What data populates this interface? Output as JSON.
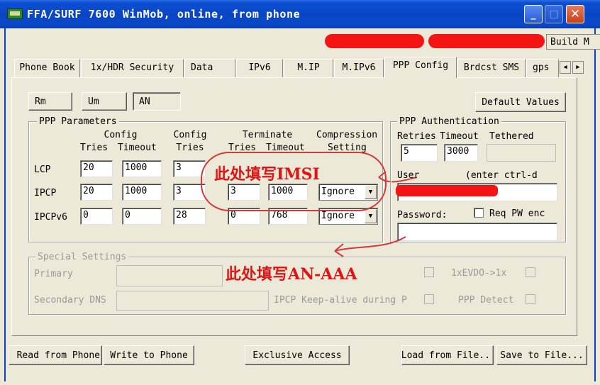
{
  "window": {
    "title": "FFA/SURF 7600 WinMob, online, from phone",
    "minimize_glyph": "_",
    "maximize_glyph": "□",
    "close_glyph": "✕",
    "build_label": "Build M"
  },
  "tabs": [
    {
      "label": "Phone Book",
      "active": false
    },
    {
      "label": "1x/HDR Security",
      "active": false
    },
    {
      "label": "Data",
      "active": false
    },
    {
      "label": "IPv6",
      "active": false
    },
    {
      "label": "M.IP",
      "active": false
    },
    {
      "label": "M.IPv6",
      "active": false
    },
    {
      "label": "PPP Config",
      "active": true
    },
    {
      "label": "Brdcst SMS",
      "active": false
    },
    {
      "label": "gps",
      "active": false
    }
  ],
  "tab_scroll": {
    "left": "◀",
    "right": "▶"
  },
  "mode_buttons": [
    {
      "label": "Rm"
    },
    {
      "label": "Um"
    },
    {
      "label": "AN",
      "selected": true
    }
  ],
  "default_values_label": "Default Values",
  "ppp_parameters": {
    "title": "PPP Parameters",
    "headers": {
      "config_group1": "Config",
      "tries1": "Tries",
      "timeout1": "Timeout",
      "config_group2": "Config",
      "tries2": "Tries",
      "terminate_group": "Terminate",
      "tries3": "Tries",
      "timeout3": "Timeout",
      "compression_group": "Compression",
      "setting": "Setting"
    },
    "rows": [
      {
        "label": "LCP",
        "config_tries": "20",
        "config_timeout": "1000",
        "config_tries2": "3",
        "term_tries": "3",
        "term_timeout": "1000",
        "compression": ""
      },
      {
        "label": "IPCP",
        "config_tries": "20",
        "config_timeout": "1000",
        "config_tries2": "3",
        "term_tries": "3",
        "term_timeout": "1000",
        "compression": "Ignore"
      },
      {
        "label": "IPCPv6",
        "config_tries": "0",
        "config_timeout": "0",
        "config_tries2": "28",
        "term_tries": "0",
        "term_timeout": "768",
        "compression": "Ignore"
      }
    ]
  },
  "ppp_auth": {
    "title": "PPP Authentication",
    "retries_label": "Retries",
    "timeout_label": "Timeout",
    "tethered_label": "Tethered",
    "retries_value": "5",
    "timeout_value": "3000",
    "user_label": "User",
    "user_hint": "(enter ctrl-d",
    "password_label": "Password:",
    "req_pw_label": "Req PW enc"
  },
  "special_settings": {
    "title": "Special Settings",
    "primary_label": "Primary",
    "secondary_label": "Secondary DNS",
    "evdo_label": "1xEVDO->1x",
    "keepalive_label": "IPCP Keep-alive during P",
    "ppp_detect_label": "PPP Detect"
  },
  "annotations": {
    "imsi": "此处填写IMSI",
    "an_aaa": "此处填写AN-AAA"
  },
  "bottom_buttons": {
    "read": "Read from Phone",
    "write": "Write to Phone",
    "exclusive": "Exclusive Access",
    "load": "Load from File..",
    "save": "Save to File..."
  },
  "colors": {
    "titlebar": "#0a46c4",
    "annotation": "#e01414",
    "redaction": "#f41414",
    "dialog_bg": "#ece9d8"
  }
}
